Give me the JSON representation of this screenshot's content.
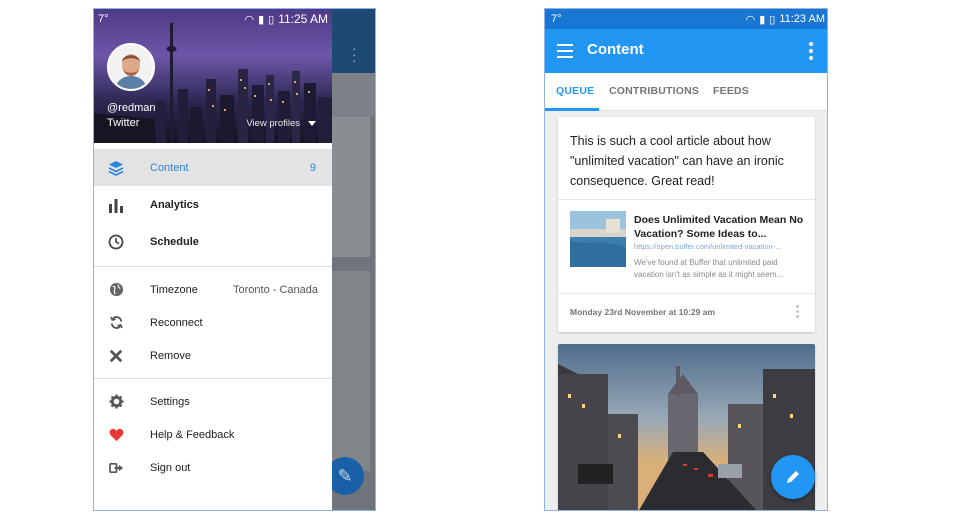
{
  "left_phone": {
    "status": {
      "temp": "7°",
      "time": "11:25 AM"
    },
    "profile": {
      "username": "@redman",
      "network": "Twitter",
      "view_profiles": "View profiles"
    },
    "menu": {
      "content": {
        "label": "Content",
        "count": "9"
      },
      "analytics": {
        "label": "Analytics"
      },
      "schedule": {
        "label": "Schedule"
      },
      "timezone": {
        "label": "Timezone",
        "value": "Toronto - Canada"
      },
      "reconnect": {
        "label": "Reconnect"
      },
      "remove": {
        "label": "Remove"
      },
      "settings": {
        "label": "Settings"
      },
      "help": {
        "label": "Help & Feedback"
      },
      "signout": {
        "label": "Sign out"
      }
    },
    "icons": [
      "layers-icon",
      "bar-chart-icon",
      "clock-icon",
      "globe-icon",
      "refresh-icon",
      "close-icon",
      "gear-icon",
      "heart-icon",
      "sign-out-icon"
    ]
  },
  "right_phone": {
    "status": {
      "temp": "7°",
      "time": "11:23 AM"
    },
    "toolbar": {
      "title": "Content"
    },
    "tabs": [
      "QUEUE",
      "CONTRIBUTIONS",
      "FEEDS"
    ],
    "card1": {
      "text": "This is such a cool article about how \"unlimited vacation\" can have an ironic consequence. Great read!",
      "link_title": "Does Unlimited Vacation Mean No Vacation? Some Ideas to...",
      "link_url": "https://open.buffer.com/unlimited-vacation-...",
      "link_desc": "We've found at Buffer that unlimited paid vacation isn't as simple as it might seem...",
      "footer": "Monday 23rd November at 10:29 am"
    }
  },
  "colors": {
    "accent": "#2196f3",
    "status_dark": "#1976d2",
    "heart": "#e53935"
  }
}
